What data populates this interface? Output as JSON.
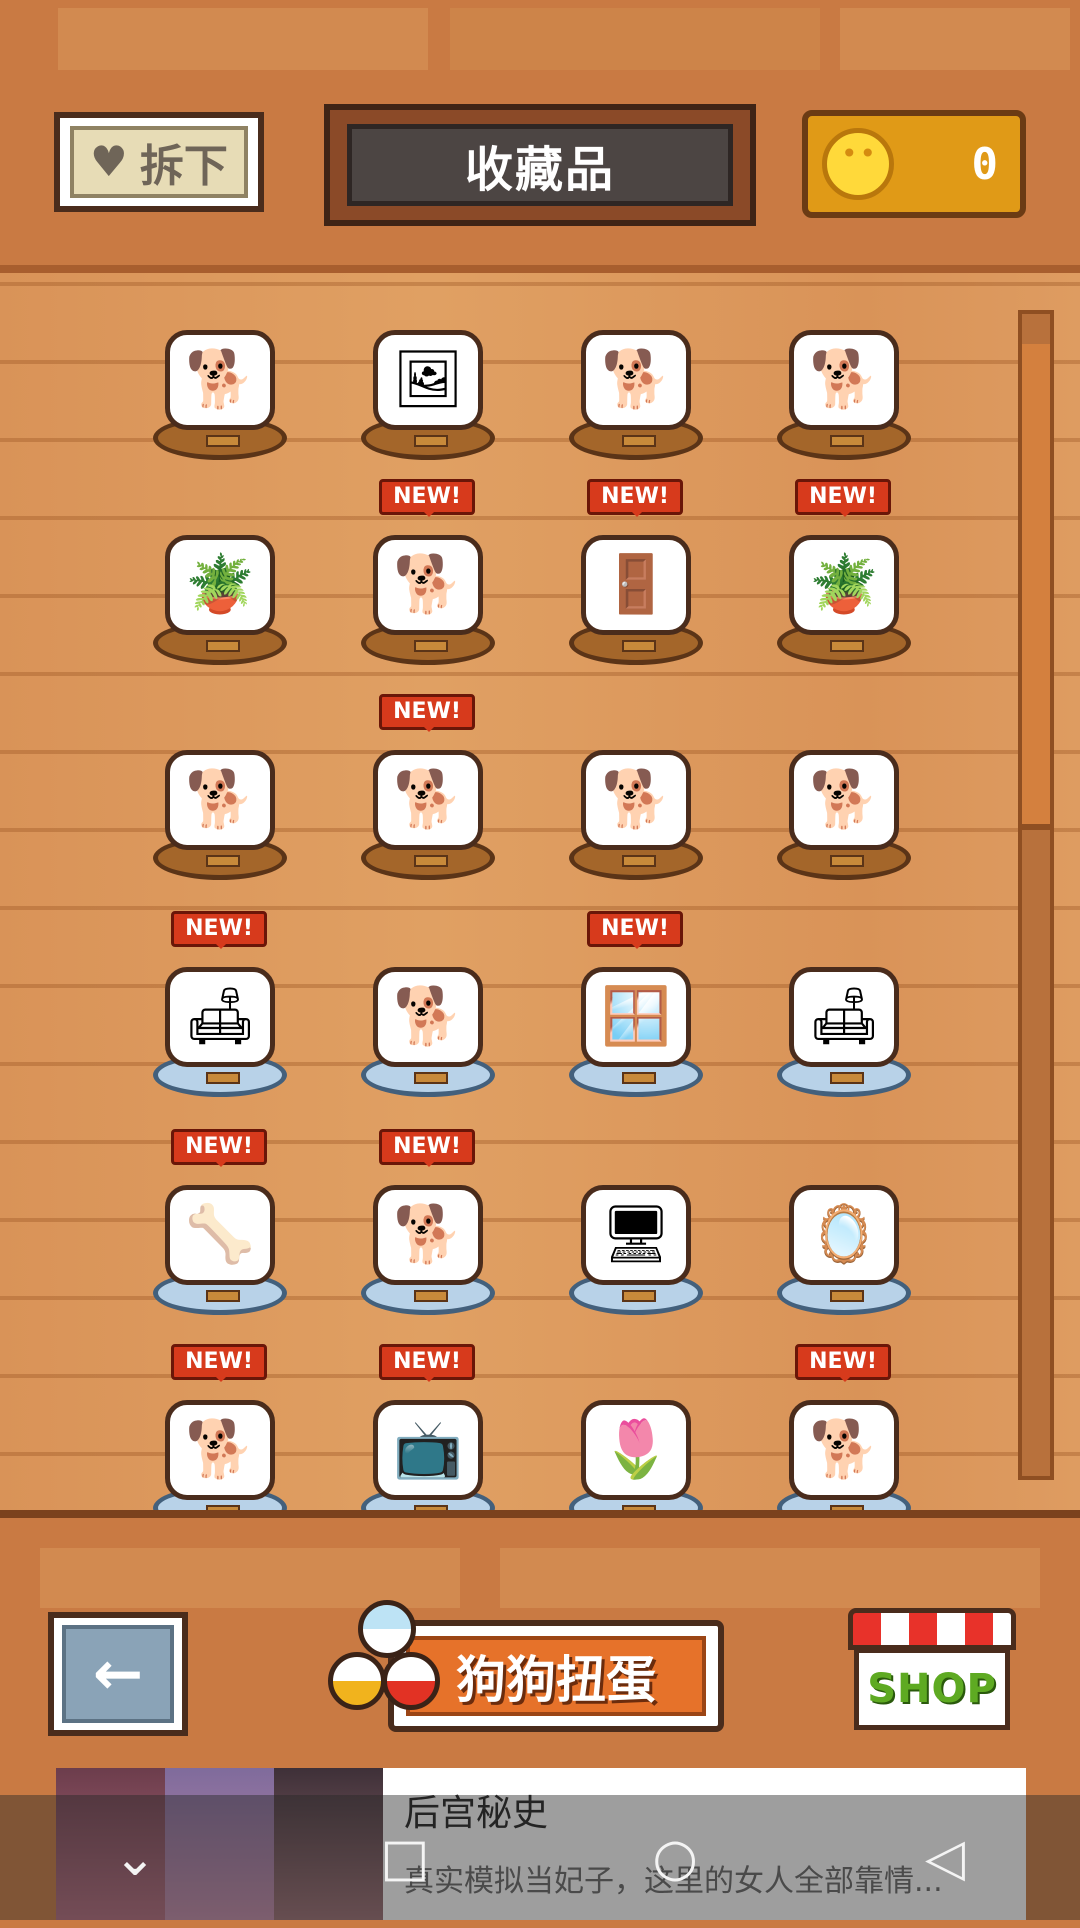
{
  "header": {
    "remove_label": "拆下",
    "remove_icon": "heart-icon",
    "title": "收藏品",
    "coin_count": "0",
    "coin_icon": "paw-coin-icon"
  },
  "new_tag": "NEW!",
  "collection": {
    "rows": [
      [
        {
          "new": false,
          "icon": "🐕",
          "base": "wood"
        },
        {
          "new": false,
          "icon": "🖼",
          "base": "wood"
        },
        {
          "new": false,
          "icon": "🐕",
          "base": "wood"
        },
        {
          "new": false,
          "icon": "🐕",
          "base": "wood"
        }
      ],
      [
        {
          "new": false,
          "icon": "🪴",
          "base": "wood"
        },
        {
          "new": true,
          "icon": "🐕",
          "base": "wood"
        },
        {
          "new": true,
          "icon": "🚪",
          "base": "wood"
        },
        {
          "new": true,
          "icon": "🪴",
          "base": "wood"
        }
      ],
      [
        {
          "new": false,
          "icon": "🐕",
          "base": "wood"
        },
        {
          "new": true,
          "icon": "🐕",
          "base": "wood"
        },
        {
          "new": false,
          "icon": "🐕",
          "base": "wood"
        },
        {
          "new": false,
          "icon": "🐕",
          "base": "wood"
        }
      ],
      [
        {
          "new": true,
          "icon": "🛋",
          "base": "glass"
        },
        {
          "new": false,
          "icon": "🐕",
          "base": "glass"
        },
        {
          "new": true,
          "icon": "🪟",
          "base": "glass"
        },
        {
          "new": false,
          "icon": "🛋",
          "base": "glass"
        }
      ],
      [
        {
          "new": true,
          "icon": "🦴",
          "base": "glass"
        },
        {
          "new": true,
          "icon": "🐕",
          "base": "glass"
        },
        {
          "new": false,
          "icon": "🖥",
          "base": "glass"
        },
        {
          "new": false,
          "icon": "🪞",
          "base": "glass"
        }
      ],
      [
        {
          "new": true,
          "icon": "🐕",
          "base": "glass"
        },
        {
          "new": true,
          "icon": "📺",
          "base": "glass"
        },
        {
          "new": false,
          "icon": "🌷",
          "base": "glass"
        },
        {
          "new": true,
          "icon": "🐕",
          "base": "glass"
        }
      ]
    ]
  },
  "footer": {
    "back_icon": "arrow-left-icon",
    "back_glyph": "←",
    "gacha_label": "狗狗扭蛋",
    "shop_label": "SHOP"
  },
  "ad": {
    "title": "后宫秘史",
    "description": "真实模拟当妃子，这里的女人全部靠情..."
  },
  "navbar": {
    "back": "◁",
    "home": "○",
    "recents": "□",
    "hide": "⌄"
  },
  "colors": {
    "wood": "#d99358",
    "accent_red": "#d73a1c",
    "coin_gold": "#e09a17"
  }
}
